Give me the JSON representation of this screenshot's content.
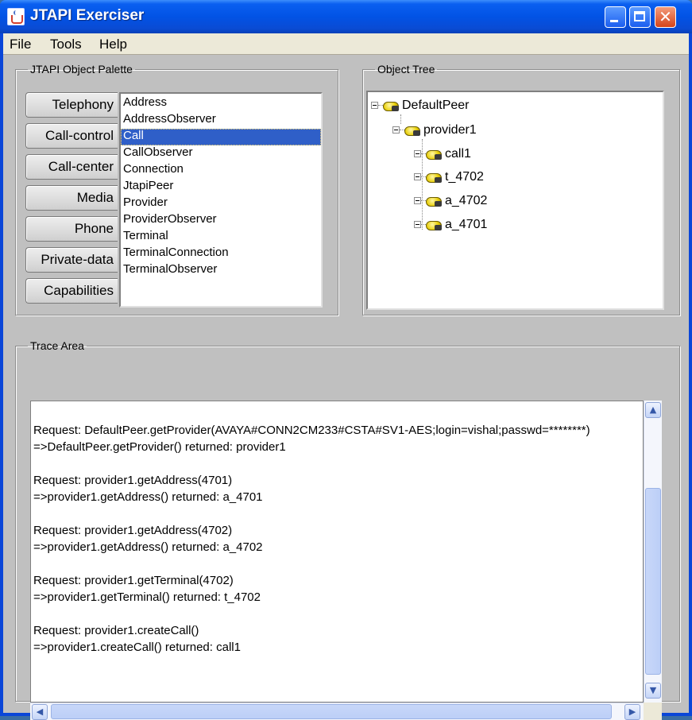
{
  "window": {
    "title": "JTAPI Exerciser"
  },
  "menu": [
    "File",
    "Tools",
    "Help"
  ],
  "palette": {
    "legend": "JTAPI Object Palette",
    "tabs": [
      "Telephony",
      "Call-control",
      "Call-center",
      "Media",
      "Phone",
      "Private-data",
      "Capabilities"
    ],
    "items": [
      "Address",
      "AddressObserver",
      "Call",
      "CallObserver",
      "Connection",
      "JtapiPeer",
      "Provider",
      "ProviderObserver",
      "Terminal",
      "TerminalConnection",
      "TerminalObserver"
    ],
    "selected_item": "Call"
  },
  "object_tree": {
    "legend": "Object Tree",
    "root": "DefaultPeer",
    "provider": "provider1",
    "children": [
      "call1",
      "t_4702",
      "a_4702",
      "a_4701"
    ]
  },
  "trace": {
    "legend": "Trace Area",
    "lines": [
      "Request: DefaultPeer.getProvider(AVAYA#CONN2CM233#CSTA#SV1-AES;login=vishal;passwd=********)",
      "=>DefaultPeer.getProvider() returned: provider1",
      "",
      "Request: provider1.getAddress(4701)",
      "=>provider1.getAddress() returned: a_4701",
      "",
      "Request: provider1.getAddress(4702)",
      "=>provider1.getAddress() returned: a_4702",
      "",
      "Request: provider1.getTerminal(4702)",
      "=>provider1.getTerminal() returned: t_4702",
      "",
      "Request: provider1.createCall()",
      "=>provider1.createCall() returned: call1"
    ]
  },
  "colors": {
    "titlebar": "#0253e5",
    "selection": "#2f5fc8",
    "panel": "#c0c0c0"
  }
}
